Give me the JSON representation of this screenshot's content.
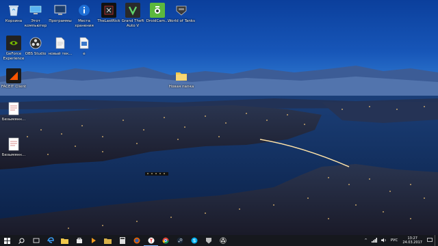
{
  "desktop": {
    "icons": [
      {
        "label": "Корзина",
        "icon": "recycle-bin"
      },
      {
        "label": "Этот компьютер",
        "icon": "this-pc"
      },
      {
        "label": "Программы",
        "icon": "programs"
      },
      {
        "label": "Места хранения",
        "icon": "info"
      },
      {
        "label": "TheLastRick",
        "icon": "game-tile"
      },
      {
        "label": "Grand Theft Auto V",
        "icon": "gta-v"
      },
      {
        "label": "DroidCam...",
        "icon": "droidcam"
      },
      {
        "label": "World of Tanks",
        "icon": "world-of-tanks"
      },
      {
        "label": "GeForce Experience",
        "icon": "geforce"
      },
      {
        "label": "OBS Studio",
        "icon": "obs"
      },
      {
        "label": "новый тек...",
        "icon": "text-file"
      },
      {
        "label": "e",
        "icon": "script-file"
      },
      {
        "label": "FACEIT Client",
        "icon": "faceit"
      },
      {
        "label": "Новая папка",
        "icon": "folder"
      },
      {
        "label": "Безымянн...",
        "icon": "document"
      },
      {
        "label": "Безымянн...",
        "icon": "document"
      }
    ]
  },
  "taskbar": {
    "items": [
      "windows-start",
      "search",
      "task-view",
      "edge",
      "explorer",
      "store",
      "app-orange",
      "folder",
      "calculator",
      "firefox",
      "yandex",
      "chrome",
      "steam",
      "skype",
      "game",
      "obs"
    ],
    "tray": {
      "expand": "^",
      "language": "РУС",
      "time": "13:27",
      "date": "24.03.2017"
    }
  },
  "colors": {
    "taskbar": "#16181d",
    "accent": "#7fb8ff"
  }
}
